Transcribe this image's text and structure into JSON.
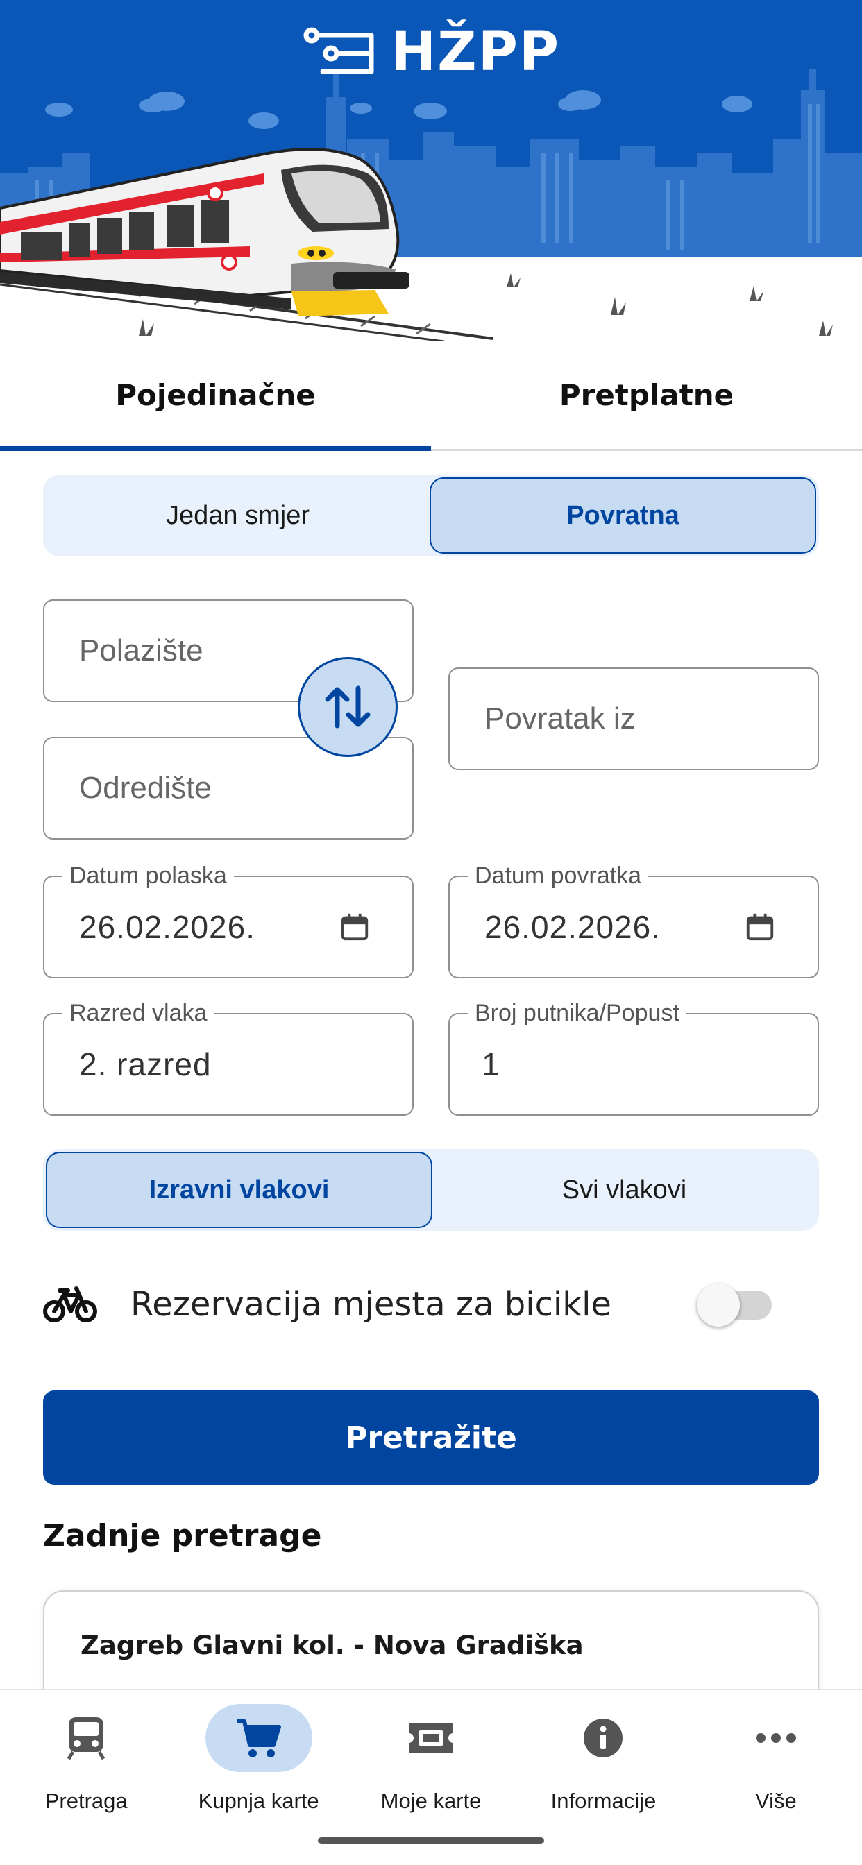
{
  "app": {
    "logo_text": "HŽPP"
  },
  "tabs": [
    {
      "label": "Pojedinačne",
      "active": true
    },
    {
      "label": "Pretplatne",
      "active": false
    }
  ],
  "trip_type": {
    "options": [
      "Jedan smjer",
      "Povratna"
    ],
    "selected": "Povratna"
  },
  "stations": {
    "origin_placeholder": "Polazište",
    "destination_placeholder": "Odredište",
    "return_from_placeholder": "Povratak iz"
  },
  "dates": {
    "departure_label": "Datum polaska",
    "departure_value": "26.02.2026.",
    "return_label": "Datum povratka",
    "return_value": "26.02.2026."
  },
  "options": {
    "class_label": "Razred vlaka",
    "class_value": "2. razred",
    "passengers_label": "Broj putnika/Popust",
    "passengers_value": "1"
  },
  "train_filter": {
    "options": [
      "Izravni vlakovi",
      "Svi vlakovi"
    ],
    "selected": "Izravni vlakovi"
  },
  "bike": {
    "label": "Rezervacija mjesta za bicikle",
    "enabled": false,
    "icon": "bicycle-icon"
  },
  "search_button": "Pretražite",
  "recent": {
    "title": "Zadnje pretrage",
    "items": [
      {
        "route": "Zagreb Glavni kol. - Nova Gradiška"
      }
    ]
  },
  "bottom_nav": [
    {
      "label": "Pretraga",
      "icon": "train-icon",
      "active": false
    },
    {
      "label": "Kupnja karte",
      "icon": "cart-icon",
      "active": true
    },
    {
      "label": "Moje karte",
      "icon": "ticket-icon",
      "active": false
    },
    {
      "label": "Informacije",
      "icon": "info-icon",
      "active": false
    },
    {
      "label": "Više",
      "icon": "more-icon",
      "active": false
    }
  ],
  "colors": {
    "primary": "#0046a0",
    "selected_bg": "#c7dcf3",
    "segment_bg": "#e9f2fc",
    "banner_blue": "#0b57b8"
  }
}
